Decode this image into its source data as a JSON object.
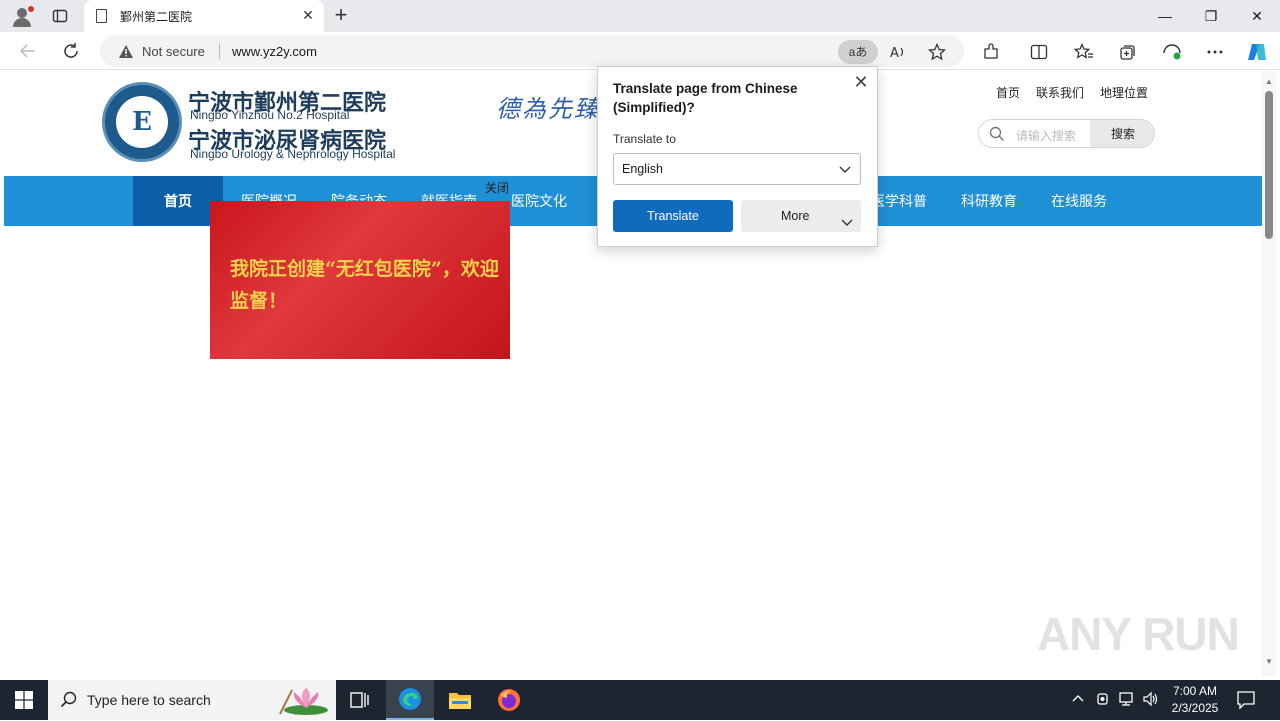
{
  "browser": {
    "tab_title": "鄞州第二医院",
    "new_tab": "+",
    "close_tab": "✕",
    "security_label": "Not secure",
    "url": "www.yz2y.com",
    "translate_pill": "aあ",
    "window_controls": {
      "minimize": "—",
      "restore": "❐",
      "close": "✕"
    }
  },
  "site": {
    "hospital1_cn": "宁波市鄞州第二医院",
    "hospital1_en": "Ningbo Yinzhou No.2 Hospital",
    "hospital2_cn": "宁波市泌尿肾病医院",
    "hospital2_en": "Ningbo Urology & Nephrology Hospital",
    "slogan": "德為先臻",
    "top_links": [
      "首页",
      "联系我们",
      "地理位置"
    ],
    "search_placeholder": "请输入搜索",
    "search_button": "搜索",
    "nav": [
      "首页",
      "医院概况",
      "院务动态",
      "就医指南",
      "医院文化",
      "医学科普",
      "科研教育",
      "在线服务"
    ],
    "popup_close": "关闭",
    "banner_text": "我院正创建“无红包医院”，欢迎监督！"
  },
  "translate_popup": {
    "title": "Translate page from Chinese (Simplified)?",
    "to_label": "Translate to",
    "selected_language": "English",
    "translate_button": "Translate",
    "more_button": "More"
  },
  "watermark": "ANY RUN",
  "taskbar": {
    "search_placeholder": "Type here to search",
    "time": "7:00 AM",
    "date": "2/3/2025"
  },
  "colors": {
    "nav_blue": "#1f8fd6",
    "nav_active": "#0c5fa6",
    "banner_red": "#c9161d",
    "banner_text": "#f5d34b",
    "translate_blue": "#0f6cbd"
  }
}
